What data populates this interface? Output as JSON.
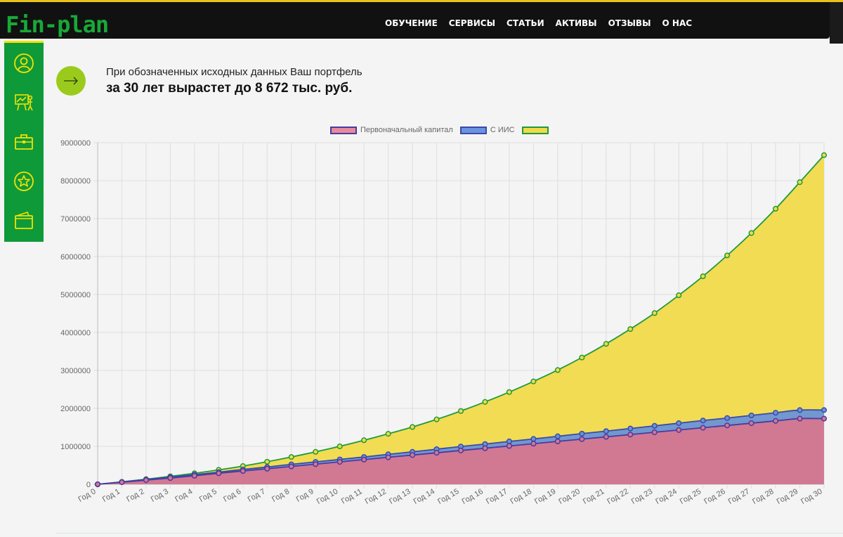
{
  "header": {
    "logo": "Fin-plan",
    "nav": [
      "ОБУЧЕНИЕ",
      "СЕРВИСЫ",
      "СТАТЬИ",
      "АКТИВЫ",
      "ОТЗЫВЫ",
      "О НАС"
    ]
  },
  "sidebar": {
    "icons": [
      "user-icon",
      "presentation-icon",
      "briefcase-icon",
      "star-icon",
      "wallet-icon"
    ]
  },
  "summary": {
    "line1": "При обозначенных исходных данных Ваш портфель",
    "line2": "за 30 лет вырастет до 8 672 тыс. руб."
  },
  "colors": {
    "green": "#18a837",
    "sidebar": "#0f9a3a",
    "accent_yellow": "#f3e200",
    "arrow_button": "#9acb1c",
    "series_initial_fill": "#d6778f",
    "series_initial_line": "#4a3aa0",
    "series_iis_fill": "#6a93d6",
    "series_iis_line": "#3a4aa8",
    "series_total_fill": "#f1da4a",
    "series_total_line": "#1e9b3c"
  },
  "chart_data": {
    "type": "area",
    "title": "",
    "xlabel": "",
    "ylabel": "",
    "ylim": [
      0,
      9000000
    ],
    "yticks": [
      0,
      1000000,
      2000000,
      3000000,
      4000000,
      5000000,
      6000000,
      7000000,
      8000000,
      9000000
    ],
    "grid": true,
    "legend_position": "top",
    "categories": [
      "Год 0",
      "Год 1",
      "Год 2",
      "Год 3",
      "Год 4",
      "Год 5",
      "Год 6",
      "Год 7",
      "Год 8",
      "Год 9",
      "Год 10",
      "Год 11",
      "Год 12",
      "Год 13",
      "Год 14",
      "Год 15",
      "Год 16",
      "Год 17",
      "Год 18",
      "Год 19",
      "Год 20",
      "Год 21",
      "Год 22",
      "Год 23",
      "Год 24",
      "Год 25",
      "Год 26",
      "Год 27",
      "Год 28",
      "Год 29",
      "Год 30"
    ],
    "series": [
      {
        "name": "Первоначальный капитал",
        "values": [
          0,
          55000,
          110000,
          165000,
          225000,
          290000,
          350000,
          410000,
          470000,
          530000,
          590000,
          650000,
          710000,
          770000,
          830000,
          890000,
          950000,
          1010000,
          1070000,
          1130000,
          1190000,
          1250000,
          1310000,
          1370000,
          1430000,
          1490000,
          1550000,
          1610000,
          1670000,
          1730000,
          1730000
        ]
      },
      {
        "name": "С ИИС",
        "values": [
          0,
          60000,
          125000,
          190000,
          255000,
          320000,
          390000,
          455000,
          525000,
          590000,
          655000,
          720000,
          790000,
          855000,
          925000,
          995000,
          1060000,
          1130000,
          1195000,
          1265000,
          1335000,
          1400000,
          1470000,
          1540000,
          1610000,
          1680000,
          1745000,
          1815000,
          1885000,
          1955000,
          1955000
        ]
      },
      {
        "name": "",
        "values": [
          0,
          65000,
          135000,
          210000,
          290000,
          380000,
          480000,
          595000,
          720000,
          855000,
          1000000,
          1160000,
          1330000,
          1510000,
          1710000,
          1930000,
          2170000,
          2430000,
          2710000,
          3010000,
          3340000,
          3700000,
          4090000,
          4510000,
          4980000,
          5480000,
          6030000,
          6620000,
          7260000,
          7960000,
          8672000
        ]
      }
    ]
  }
}
